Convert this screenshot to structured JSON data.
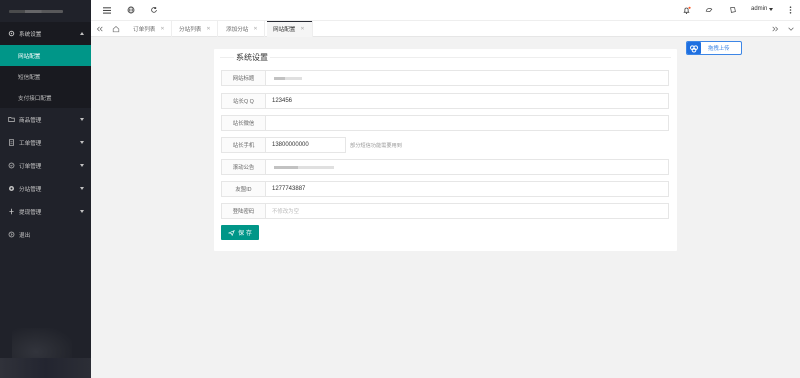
{
  "sidebar": {
    "items": [
      {
        "label": "系统设置",
        "icon": "gear-icon",
        "expanded": true,
        "children": [
          {
            "label": "网站配置",
            "active": true
          },
          {
            "label": "短信配置",
            "active": false
          },
          {
            "label": "支付接口配置",
            "active": false
          }
        ]
      },
      {
        "label": "商品管理",
        "icon": "folder-icon"
      },
      {
        "label": "工单管理",
        "icon": "document-icon"
      },
      {
        "label": "订单管理",
        "icon": "order-icon"
      },
      {
        "label": "分站管理",
        "icon": "globe-icon"
      },
      {
        "label": "提现管理",
        "icon": "withdraw-icon"
      },
      {
        "label": "退出",
        "icon": "logout-icon"
      }
    ]
  },
  "header": {
    "user": "admin"
  },
  "tabs": [
    {
      "label": "订单列表"
    },
    {
      "label": "分站列表"
    },
    {
      "label": "添加分站"
    },
    {
      "label": "网站配置",
      "active": true
    }
  ],
  "form": {
    "title": "系统设置",
    "fields": [
      {
        "label": "网站标题",
        "value": ""
      },
      {
        "label": "站长Q Q",
        "value": "123456"
      },
      {
        "label": "站长微信",
        "value": ""
      },
      {
        "label": "站长手机",
        "value": "13800000000",
        "hint": "部分短信功能需要用到"
      },
      {
        "label": "滚动公告",
        "value": ""
      },
      {
        "label": "友盟ID",
        "value": "1277743887"
      },
      {
        "label": "登陆密码",
        "placeholder": "不修改为空"
      }
    ],
    "save_label": "保 存"
  },
  "upload_button": {
    "label": "拖拽上传"
  },
  "colors": {
    "accent": "#009688",
    "sidebar_bg": "#20222a",
    "notification_dot": "#ff5722",
    "upload_blue": "#3d86e6"
  }
}
